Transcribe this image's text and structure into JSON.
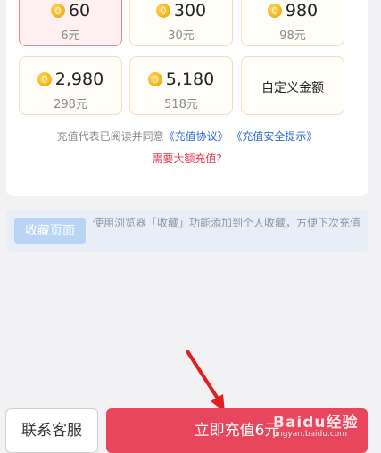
{
  "options": [
    {
      "coins": "60",
      "price": "6元",
      "selected": true
    },
    {
      "coins": "300",
      "price": "30元"
    },
    {
      "coins": "980",
      "price": "98元"
    },
    {
      "coins": "2,980",
      "price": "298元"
    },
    {
      "coins": "5,180",
      "price": "518元"
    }
  ],
  "custom_label": "自定义金额",
  "agreement": {
    "prefix": "充值代表已阅读并同意",
    "link1": "《充值协议》",
    "link2": "《充值安全提示》"
  },
  "large_amount_link": "需要大额充值?",
  "favorite": {
    "button": "收藏页面",
    "text": "使用浏览器「收藏」功能添加到个人收藏，方便下次充值"
  },
  "footer": {
    "service_button": "联系客服",
    "pay_button": "立即充值6元"
  },
  "watermark": {
    "line1": "Baidu经验",
    "line2": "jingyan.baidu.com"
  },
  "colors": {
    "accent": "#e8465c",
    "link": "#2d67d8"
  }
}
